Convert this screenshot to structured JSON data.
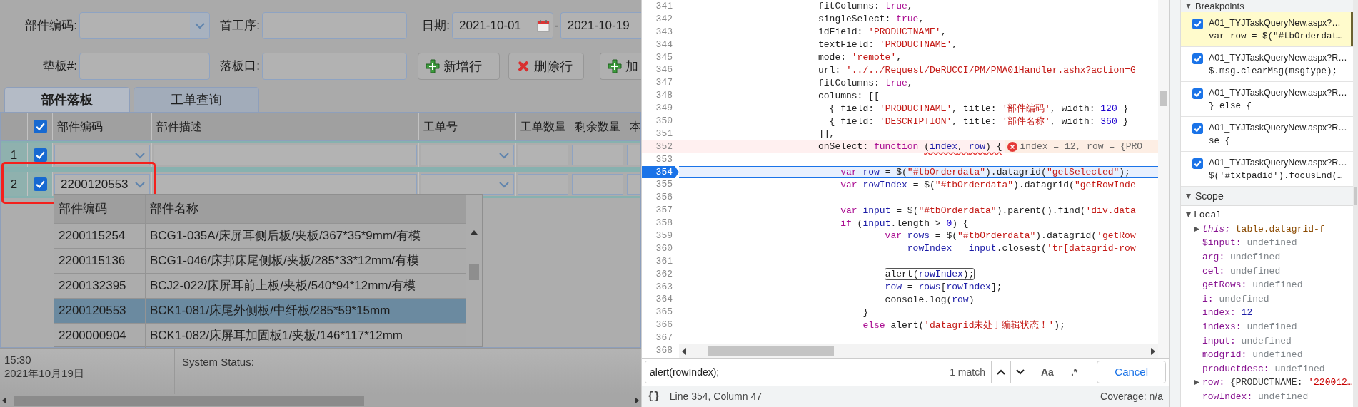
{
  "page": {
    "filter_rows": [
      {
        "fields": [
          {
            "label": "部件编码:",
            "kind": "combo"
          },
          {
            "label": "首工序:",
            "kind": "text"
          },
          {
            "label": "日期:",
            "kind": "daterange",
            "from": "2021-10-01",
            "separator": "-",
            "to": "2021-10-19"
          }
        ]
      },
      {
        "fields": [
          {
            "label": "垫板#:",
            "kind": "text"
          },
          {
            "label": "落板口:",
            "kind": "text"
          }
        ],
        "buttons": [
          {
            "label": "新增行",
            "kind": "add"
          },
          {
            "label": "删除行",
            "kind": "delete"
          },
          {
            "label": "加",
            "kind": "add"
          }
        ]
      }
    ],
    "tabs": [
      {
        "label": "部件落板",
        "selected": true
      },
      {
        "label": "工单查询",
        "selected": false
      }
    ],
    "grid": {
      "header_checked": true,
      "columns": [
        {
          "title": "部件编码",
          "kind": "combo"
        },
        {
          "title": "部件描述",
          "kind": "text"
        },
        {
          "title": "工单号",
          "kind": "combo"
        },
        {
          "title": "工单数量",
          "kind": "text"
        },
        {
          "title": "剩余数量",
          "kind": "text"
        },
        {
          "title": "本",
          "kind": "text"
        }
      ],
      "rows": [
        {
          "number": "1",
          "checked": true,
          "highlighted": false
        },
        {
          "number": "2",
          "checked": true,
          "part_code": "2200120553",
          "highlighted": true
        }
      ]
    },
    "dropdown": {
      "columns": [
        "部件编码",
        "部件名称"
      ],
      "rows": [
        {
          "code": "2200115254",
          "name": "BCG1-035A/床屏耳侧后板/夹板/367*35*9mm/有模",
          "selected": false
        },
        {
          "code": "2200115136",
          "name": "BCG1-046/床邦床尾侧板/夹板/285*33*12mm/有模",
          "selected": false
        },
        {
          "code": "2200132395",
          "name": "BCJ2-022/床屏耳前上板/夹板/540*94*12mm/有模",
          "selected": false
        },
        {
          "code": "2200120553",
          "name": "BCK1-081/床尾外侧板/中纤板/285*59*15mm",
          "selected": true
        },
        {
          "code": "2200000904",
          "name": "BCK1-082/床屏耳加固板1/夹板/146*117*12mm",
          "selected": false
        }
      ]
    },
    "status_bar": {
      "time": "15:30",
      "date": "2021年10月19日",
      "status_label": "System Status:"
    }
  },
  "source_editor": {
    "lines": [
      {
        "number": "341",
        "kind": "code",
        "tokens": [
          {
            "text": "fitColumns: ",
            "kind": "plain"
          },
          {
            "text": "true",
            "kind": "keyword"
          },
          {
            "text": ",",
            "kind": "plain"
          }
        ]
      },
      {
        "number": "342",
        "kind": "code",
        "tokens": [
          {
            "text": "singleSelect: ",
            "kind": "plain"
          },
          {
            "text": "true",
            "kind": "keyword"
          },
          {
            "text": ",",
            "kind": "plain"
          }
        ]
      },
      {
        "number": "343",
        "kind": "code",
        "tokens": [
          {
            "text": "idField: ",
            "kind": "plain"
          },
          {
            "text": "'PRODUCTNAME'",
            "kind": "string"
          },
          {
            "text": ",",
            "kind": "plain"
          }
        ]
      },
      {
        "number": "344",
        "kind": "code",
        "tokens": [
          {
            "text": "textField: ",
            "kind": "plain"
          },
          {
            "text": "'PRODUCTNAME'",
            "kind": "string"
          },
          {
            "text": ",",
            "kind": "plain"
          }
        ]
      },
      {
        "number": "345",
        "kind": "code",
        "tokens": [
          {
            "text": "mode: ",
            "kind": "plain"
          },
          {
            "text": "'remote'",
            "kind": "string"
          },
          {
            "text": ",",
            "kind": "plain"
          }
        ]
      },
      {
        "number": "346",
        "kind": "code",
        "tokens": [
          {
            "text": "url: ",
            "kind": "plain"
          },
          {
            "text": "'../../Request/DeRUCCI/PM/PMA01Handler.ashx?action=G",
            "kind": "string"
          }
        ]
      },
      {
        "number": "347",
        "kind": "code",
        "tokens": [
          {
            "text": "fitColumns: ",
            "kind": "plain"
          },
          {
            "text": "true",
            "kind": "keyword"
          },
          {
            "text": ",",
            "kind": "plain"
          }
        ]
      },
      {
        "number": "348",
        "kind": "code",
        "tokens": [
          {
            "text": "columns: [[",
            "kind": "plain"
          }
        ]
      },
      {
        "number": "349",
        "kind": "code",
        "tokens": [
          {
            "text": "  { field: ",
            "kind": "plain"
          },
          {
            "text": "'PRODUCTNAME'",
            "kind": "string"
          },
          {
            "text": ", title: ",
            "kind": "plain"
          },
          {
            "text": "'部件编码'",
            "kind": "string"
          },
          {
            "text": ", width: ",
            "kind": "plain"
          },
          {
            "text": "120",
            "kind": "number"
          },
          {
            "text": " }",
            "kind": "plain"
          }
        ]
      },
      {
        "number": "350",
        "kind": "code",
        "tokens": [
          {
            "text": "  { field: ",
            "kind": "plain"
          },
          {
            "text": "'DESCRIPTION'",
            "kind": "string"
          },
          {
            "text": ", title: ",
            "kind": "plain"
          },
          {
            "text": "'部件名称'",
            "kind": "string"
          },
          {
            "text": ", width: ",
            "kind": "plain"
          },
          {
            "text": "360",
            "kind": "number"
          },
          {
            "text": " }",
            "kind": "plain"
          }
        ]
      },
      {
        "number": "351",
        "kind": "code",
        "tokens": [
          {
            "text": "]],",
            "kind": "plain"
          }
        ]
      },
      {
        "number": "352",
        "kind": "error",
        "inline_value": "index = 12, row = {PRO",
        "tokens": [
          {
            "text": "onSelect: ",
            "kind": "plain"
          },
          {
            "text": "function ",
            "kind": "keyword"
          },
          {
            "text": "(",
            "kind": "plain",
            "squiggle": true
          },
          {
            "text": "index",
            "kind": "variable",
            "squiggle": true
          },
          {
            "text": ", ",
            "kind": "plain",
            "squiggle": true
          },
          {
            "text": "row",
            "kind": "variable",
            "squiggle": true
          },
          {
            "text": ") {",
            "kind": "plain",
            "squiggle": true
          }
        ]
      },
      {
        "number": "353",
        "kind": "code"
      },
      {
        "number": "354",
        "kind": "paused",
        "tokens": [
          {
            "text": "    var ",
            "kind": "keyword"
          },
          {
            "text": "row",
            "kind": "variable"
          },
          {
            "text": " = $(",
            "kind": "plain"
          },
          {
            "text": "\"#tbOrderdata\"",
            "kind": "string"
          },
          {
            "text": ").datagrid(",
            "kind": "plain"
          },
          {
            "text": "\"getSelected\"",
            "kind": "string"
          },
          {
            "text": ");",
            "kind": "plain"
          }
        ]
      },
      {
        "number": "355",
        "kind": "code",
        "tokens": [
          {
            "text": "    var ",
            "kind": "keyword"
          },
          {
            "text": "rowIndex",
            "kind": "variable"
          },
          {
            "text": " = $(",
            "kind": "plain"
          },
          {
            "text": "\"#tbOrderdata\"",
            "kind": "string"
          },
          {
            "text": ").datagrid(",
            "kind": "plain"
          },
          {
            "text": "\"getRowInde",
            "kind": "string"
          }
        ]
      },
      {
        "number": "356",
        "kind": "code"
      },
      {
        "number": "357",
        "kind": "code",
        "tokens": [
          {
            "text": "    var ",
            "kind": "keyword"
          },
          {
            "text": "input",
            "kind": "variable"
          },
          {
            "text": " = $(",
            "kind": "plain"
          },
          {
            "text": "\"#tbOrderdata\"",
            "kind": "string"
          },
          {
            "text": ").parent().find(",
            "kind": "plain"
          },
          {
            "text": "'div.data",
            "kind": "string"
          }
        ]
      },
      {
        "number": "358",
        "kind": "code",
        "tokens": [
          {
            "text": "    if ",
            "kind": "keyword"
          },
          {
            "text": "(",
            "kind": "plain"
          },
          {
            "text": "input",
            "kind": "variable"
          },
          {
            "text": ".length > ",
            "kind": "plain"
          },
          {
            "text": "0",
            "kind": "number"
          },
          {
            "text": ") {",
            "kind": "plain"
          }
        ]
      },
      {
        "number": "359",
        "kind": "code",
        "tokens": [
          {
            "text": "            var ",
            "kind": "keyword"
          },
          {
            "text": "rows",
            "kind": "variable"
          },
          {
            "text": " = $(",
            "kind": "plain"
          },
          {
            "text": "\"#tbOrderdata\"",
            "kind": "string"
          },
          {
            "text": ").datagrid(",
            "kind": "plain"
          },
          {
            "text": "'getRow",
            "kind": "string"
          }
        ]
      },
      {
        "number": "360",
        "kind": "code",
        "tokens": [
          {
            "text": "                rowIndex",
            "kind": "variable"
          },
          {
            "text": " = ",
            "kind": "plain"
          },
          {
            "text": "input",
            "kind": "variable"
          },
          {
            "text": ".closest(",
            "kind": "plain"
          },
          {
            "text": "'tr[datagrid-row",
            "kind": "string"
          }
        ]
      },
      {
        "number": "361",
        "kind": "code"
      },
      {
        "number": "362",
        "kind": "code",
        "tokens": [
          {
            "text": "            alert(",
            "kind": "plain",
            "found": true
          },
          {
            "text": "rowIndex",
            "kind": "variable",
            "found": true
          },
          {
            "text": ");",
            "kind": "plain",
            "found": true
          }
        ]
      },
      {
        "number": "363",
        "kind": "code",
        "tokens": [
          {
            "text": "            row",
            "kind": "variable"
          },
          {
            "text": " = ",
            "kind": "plain"
          },
          {
            "text": "rows",
            "kind": "variable"
          },
          {
            "text": "[",
            "kind": "plain"
          },
          {
            "text": "rowIndex",
            "kind": "variable"
          },
          {
            "text": "];",
            "kind": "plain"
          }
        ]
      },
      {
        "number": "364",
        "kind": "code",
        "tokens": [
          {
            "text": "            console.log(",
            "kind": "plain"
          },
          {
            "text": "row",
            "kind": "variable"
          },
          {
            "text": ")",
            "kind": "plain"
          }
        ]
      },
      {
        "number": "365",
        "kind": "code",
        "tokens": [
          {
            "text": "        }",
            "kind": "plain"
          }
        ]
      },
      {
        "number": "366",
        "kind": "code",
        "tokens": [
          {
            "text": "        else",
            "kind": "keyword"
          },
          {
            "text": " alert(",
            "kind": "plain"
          },
          {
            "text": "'datagrid未处于编辑状态！'",
            "kind": "string"
          },
          {
            "text": ");",
            "kind": "plain"
          }
        ]
      },
      {
        "number": "367",
        "kind": "code"
      },
      {
        "number": "368",
        "kind": "code"
      }
    ]
  },
  "find_bar": {
    "query": "alert(rowIndex);",
    "match_count": "1 match",
    "case_button": "Aa",
    "regex_button": ".*",
    "cancel_button": "Cancel"
  },
  "editor_status": {
    "format_button": "{}",
    "position": "Line 354, Column 47",
    "coverage": "Coverage: n/a"
  },
  "breakpoints": {
    "title": "Breakpoints",
    "expanded": true,
    "items": [
      {
        "location": "A01_TYJTaskQueryNew.aspx?…",
        "code": "var row = $(\"#tbOrderdat…",
        "checked": true,
        "selected": true
      },
      {
        "location": "A01_TYJTaskQueryNew.aspx?R…",
        "code": "$.msg.clearMsg(msgtype);",
        "checked": true,
        "selected": false
      },
      {
        "location": "A01_TYJTaskQueryNew.aspx?R…",
        "code": "} else {",
        "checked": true,
        "selected": false
      },
      {
        "location": "A01_TYJTaskQueryNew.aspx?R…",
        "code": "se {",
        "checked": true,
        "selected": false
      },
      {
        "location": "A01_TYJTaskQueryNew.aspx?R…",
        "code": "$('#txtpadid').focusEnd(…",
        "checked": true,
        "selected": false
      }
    ]
  },
  "scope": {
    "title": "Scope",
    "expanded": true,
    "children": [
      {
        "name": "Local",
        "expanded": true,
        "children": [
          {
            "name": "this:",
            "italic": true,
            "expanded": false,
            "value": [
              {
                "text": "table.datagrid-f",
                "kind": "object"
              }
            ]
          },
          {
            "name": "$input:",
            "value": [
              {
                "text": "undefined",
                "kind": "undefined"
              }
            ]
          },
          {
            "name": "arg:",
            "value": [
              {
                "text": "undefined",
                "kind": "undefined"
              }
            ]
          },
          {
            "name": "cel:",
            "value": [
              {
                "text": "undefined",
                "kind": "undefined"
              }
            ]
          },
          {
            "name": "getRows:",
            "value": [
              {
                "text": "undefined",
                "kind": "undefined"
              }
            ]
          },
          {
            "name": "i:",
            "value": [
              {
                "text": "undefined",
                "kind": "undefined"
              }
            ]
          },
          {
            "name": "index:",
            "value": [
              {
                "text": "12",
                "kind": "number"
              }
            ]
          },
          {
            "name": "indexs:",
            "value": [
              {
                "text": "undefined",
                "kind": "undefined"
              }
            ]
          },
          {
            "name": "input:",
            "value": [
              {
                "text": "undefined",
                "kind": "undefined"
              }
            ]
          },
          {
            "name": "modgrid:",
            "value": [
              {
                "text": "undefined",
                "kind": "undefined"
              }
            ]
          },
          {
            "name": "productdesc:",
            "value": [
              {
                "text": "undefined",
                "kind": "undefined"
              }
            ]
          },
          {
            "name": "row:",
            "expanded": false,
            "value": [
              {
                "text": "{PRODUCTNAME: ",
                "kind": "plain"
              },
              {
                "text": "'220012…",
                "kind": "string"
              }
            ]
          },
          {
            "name": "rowIndex:",
            "value": [
              {
                "text": "undefined",
                "kind": "undefined"
              }
            ]
          }
        ]
      }
    ]
  }
}
